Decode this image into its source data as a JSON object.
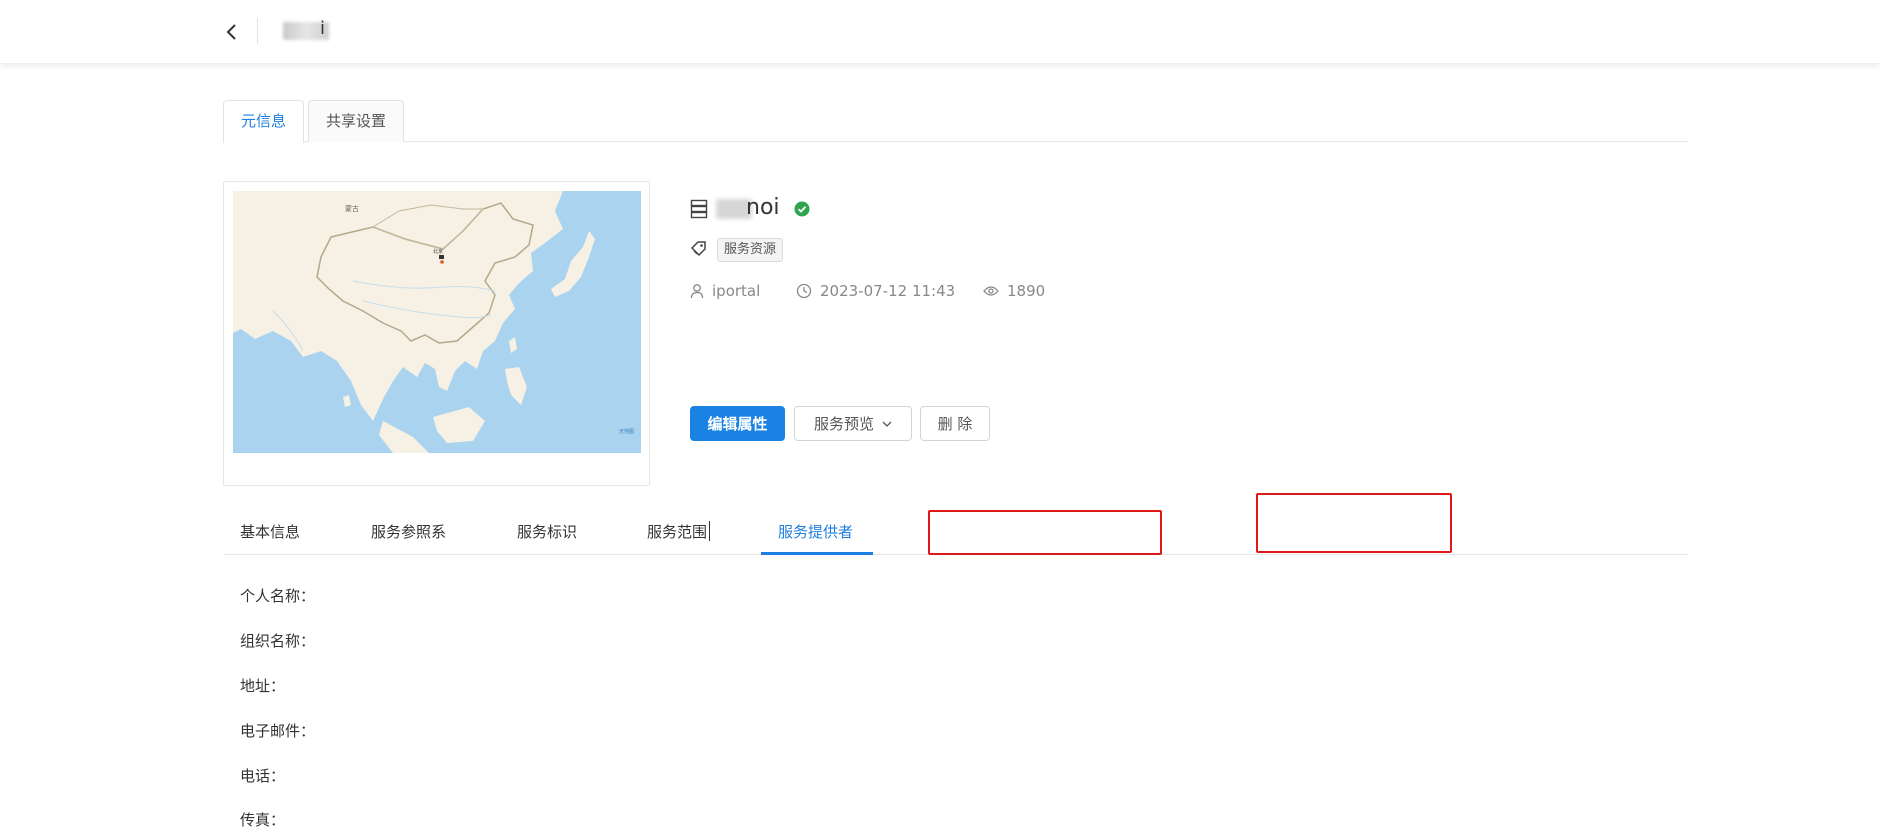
{
  "header": {
    "title_tail": "i"
  },
  "card_tabs": [
    {
      "label": "元信息",
      "active": true
    },
    {
      "label": "共享设置",
      "active": false
    }
  ],
  "resource": {
    "title_tail": "noi",
    "tag": "服务资源",
    "owner": "iportal",
    "datetime": "2023-07-12 11:43",
    "views": "1890",
    "map_labels": {
      "country": "蒙古",
      "city": "北京",
      "attribution": "天地图"
    }
  },
  "actions": {
    "edit": "编辑属性",
    "preview": "服务预览",
    "delete": "删 除"
  },
  "sub_tabs": [
    {
      "label": "基本信息",
      "active": false
    },
    {
      "label": "服务参照系",
      "active": false
    },
    {
      "label": "服务标识",
      "active": false
    },
    {
      "label": "服务范围",
      "active": false
    },
    {
      "label": "服务提供者",
      "active": true
    }
  ],
  "provider_fields": [
    {
      "label": "个人名称："
    },
    {
      "label": "组织名称："
    },
    {
      "label": "地址："
    },
    {
      "label": "电子邮件："
    },
    {
      "label": "电话："
    },
    {
      "label": "传真："
    }
  ],
  "colors": {
    "primary": "#1a82e2",
    "active_tab": "#1f7fe0",
    "verified": "#2ea44f",
    "annotation": "#e01818",
    "map_water": "#a9d3ee",
    "map_land": "#f6f1e4"
  }
}
